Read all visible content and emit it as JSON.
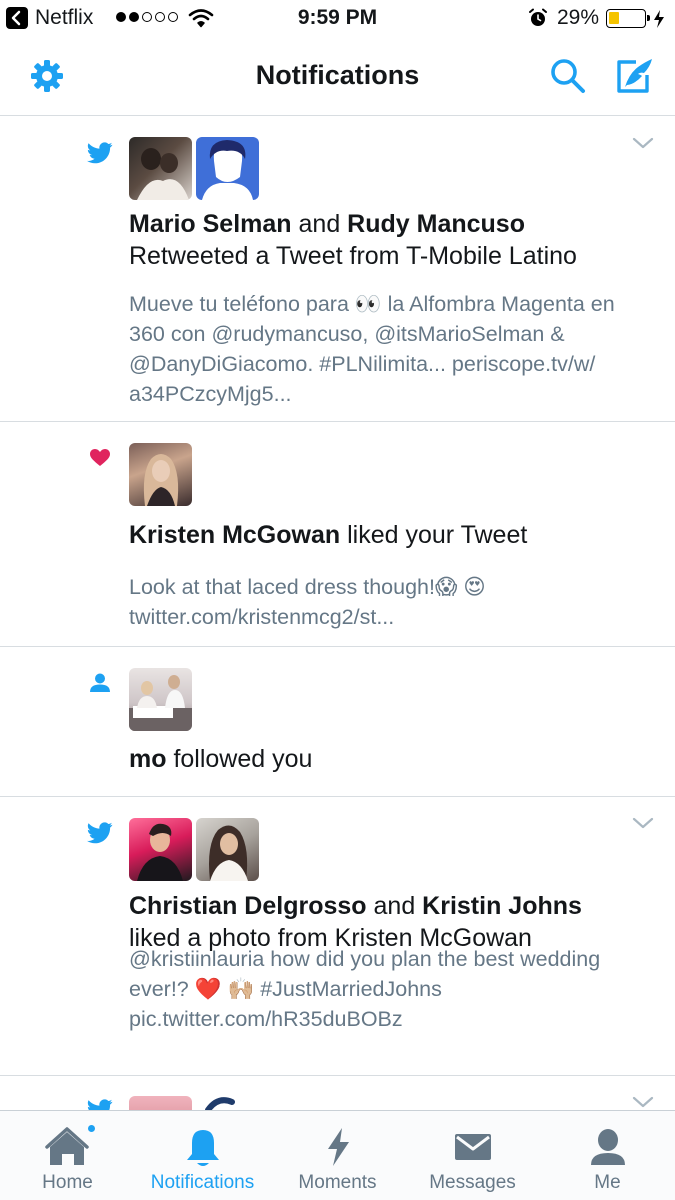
{
  "status_bar": {
    "back_app": "Netflix",
    "time": "9:59 PM",
    "battery": "29%",
    "battery_level": 0.29
  },
  "header": {
    "title": "Notifications",
    "icons": [
      "gear-icon",
      "search-icon",
      "compose-icon"
    ]
  },
  "notifications": [
    {
      "type": "retweet",
      "icon": "twitter-bird-icon",
      "actor_1": "Mario Selman",
      "connector": " and ",
      "actor_2": "Rudy Mancuso",
      "action": "Retweeted a Tweet from T-Mobile Latino",
      "snippet_1": "Mueve tu teléfono para 👀  la Alfombra Magenta en 360 con @rudymancuso, @itsMarioSelman & @DanyDiGiacomo. #PLNilimita... periscope.tv/w/",
      "snippet_2": "a34PCzcyMjg5..."
    },
    {
      "type": "like",
      "icon": "heart-icon",
      "actor_1": "Kristen McGowan",
      "action": " liked your Tweet",
      "snippet_1": "Look at that laced dress though!😱 😍",
      "snippet_2": "twitter.com/kristenmcg2/st..."
    },
    {
      "type": "follow",
      "icon": "person-icon",
      "actor_1": "mo",
      "action": " followed you"
    },
    {
      "type": "like",
      "icon": "twitter-bird-icon",
      "actor_1": "Christian Delgrosso",
      "connector": " and ",
      "actor_2": "Kristin Johns",
      "action": "liked a photo from Kristen McGowan",
      "snippet_1": "@kristiinlauria how did you plan the best wedding ever!? ❤️ 🙌🏼  #JustMarriedJohns",
      "snippet_2": "pic.twitter.com/hR35duBOBz"
    }
  ],
  "tabs": [
    {
      "label": "Home",
      "icon": "home-icon",
      "active": false
    },
    {
      "label": "Notifications",
      "icon": "bell-icon",
      "active": true
    },
    {
      "label": "Moments",
      "icon": "lightning-icon",
      "active": false
    },
    {
      "label": "Messages",
      "icon": "envelope-icon",
      "active": false
    },
    {
      "label": "Me",
      "icon": "person-icon",
      "active": false
    }
  ],
  "colors": {
    "accent": "#1da1f2",
    "like": "#e0245e",
    "text": "#14171a",
    "secondary_text": "#657786",
    "divider": "#d8dde1"
  }
}
